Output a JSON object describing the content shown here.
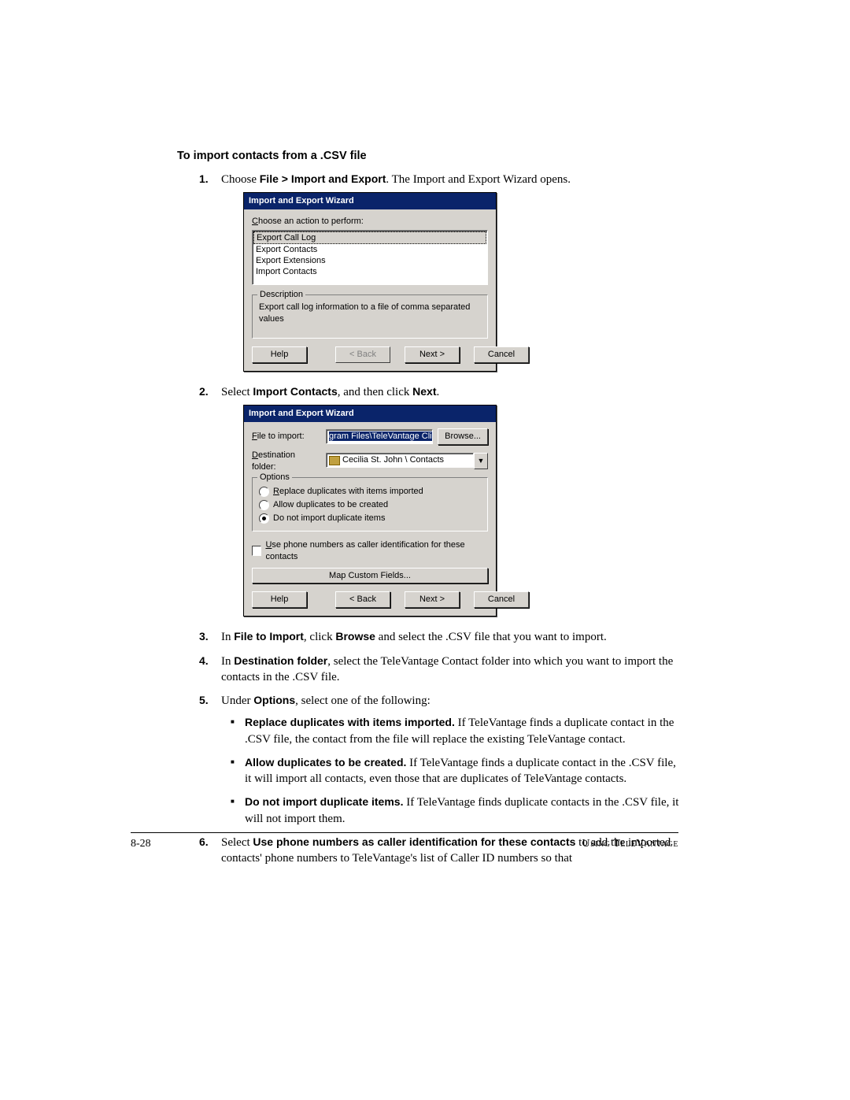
{
  "section_title": "To import contacts from a .CSV file",
  "steps": {
    "s1": {
      "num": "1.",
      "pre": "Choose ",
      "bold": "File > Import and Export",
      "post": ". The Import and Export Wizard opens."
    },
    "s2": {
      "num": "2.",
      "pre": "Select ",
      "bold1": "Import Contacts",
      "mid": ", and then click ",
      "bold2": "Next",
      "post": "."
    },
    "s3": {
      "num": "3.",
      "pre": "In ",
      "bold1": "File to Import",
      "mid": ", click ",
      "bold2": "Browse",
      "post": " and select the .CSV file that you want to import."
    },
    "s4": {
      "num": "4.",
      "pre": "In ",
      "bold1": "Destination folder",
      "post": ", select the TeleVantage Contact folder into which you want to import the contacts in the .CSV file."
    },
    "s5": {
      "num": "5.",
      "pre": "Under ",
      "bold1": "Options",
      "post": ", select one of the following:"
    },
    "s6": {
      "num": "6.",
      "pre": "Select ",
      "bold1": "Use phone numbers as caller identification for these contacts",
      "post": " to add the imported contacts' phone numbers to TeleVantage's list of Caller ID numbers so that"
    }
  },
  "bullets": {
    "b1": {
      "bold": "Replace duplicates with items imported.",
      "text": " If TeleVantage finds a duplicate contact in the .CSV file, the contact from the file will replace the existing TeleVantage contact."
    },
    "b2": {
      "bold": "Allow duplicates to be created.",
      "text": " If TeleVantage finds a duplicate contact in the .CSV file, it will import all contacts, even those that are duplicates of TeleVantage contacts."
    },
    "b3": {
      "bold": "Do not import duplicate items.",
      "text": " If TeleVantage finds duplicate contacts in the .CSV file, it will not import them."
    }
  },
  "dialog1": {
    "title": "Import and Export Wizard",
    "choose_label": "Choose an action to perform:",
    "items": [
      "Export Call Log",
      "Export Contacts",
      "Export Extensions",
      "Import Contacts"
    ],
    "desc_legend": "Description",
    "desc_text": "Export call log information to a file of comma separated values",
    "help": "Help",
    "back": "< Back",
    "next": "Next >",
    "cancel": "Cancel"
  },
  "dialog2": {
    "title": "Import and Export Wizard",
    "file_label": "File to import:",
    "file_value": "gram Files\\TeleVantage Client\\Contacts.csv",
    "browse": "Browse...",
    "dest_label": "Destination folder:",
    "dest_value": "Cecilia St. John \\ Contacts",
    "options_legend": "Options",
    "opt1": "Replace duplicates with items imported",
    "opt2": "Allow duplicates to be created",
    "opt3": "Do not import duplicate items",
    "check_label": "Use phone numbers as caller identification for these contacts",
    "map_btn": "Map Custom Fields...",
    "help": "Help",
    "back": "< Back",
    "next": "Next >",
    "cancel": "Cancel"
  },
  "footer": {
    "page": "8-28",
    "title": "Using TeleVantage"
  }
}
